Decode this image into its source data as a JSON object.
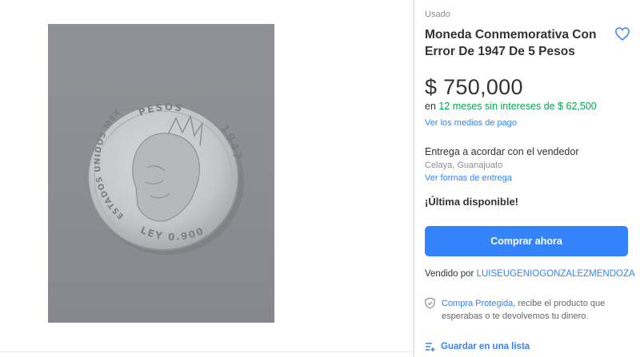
{
  "listing": {
    "condition": "Usado",
    "title": "Moneda Conmemorativa Con Error De 1947 De 5 Pesos",
    "price": "$ 750,000",
    "installments": {
      "prefix": "en",
      "highlight": "12 meses sin intereses de $ 62,500"
    },
    "payment_link": "Ver los medios de pago",
    "delivery": "Entrega a acordar con el vendedor",
    "location": "Celaya, Guanajuato",
    "delivery_link": "Ver formas de entrega",
    "stock": "¡Última disponible!",
    "buy_button": "Comprar ahora",
    "seller": {
      "prefix": "Vendido por",
      "name": "LUISEUGENIOGONZALEZMENDOZA"
    },
    "protection": {
      "link": "Compra Protegida",
      "text": ", recibe el producto que esperabas o te devolvemos tu dinero."
    },
    "wishlist": "Guardar en una lista"
  },
  "coin": {
    "top_text": "PESOS",
    "left_text": "ESTADOS UNIDOS MEXICANOS",
    "bottom_text": "LEY 0.900",
    "year": "1947"
  },
  "colors": {
    "accent": "#3483fa",
    "green": "#00a650",
    "coin_silver": "#c9cbce"
  },
  "icons": {
    "favorite": "heart-outline-icon",
    "protection": "shield-icon",
    "wishlist": "list-add-icon"
  }
}
